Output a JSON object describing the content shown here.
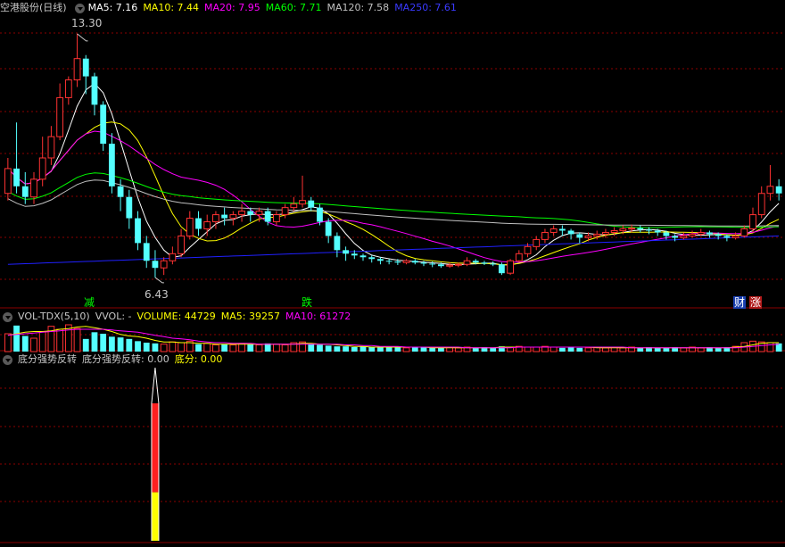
{
  "header_price": {
    "title": "空港股份(日线)",
    "ma5_label": "MA5: 7.16",
    "ma10_label": "MA10: 7.44",
    "ma20_label": "MA20: 7.95",
    "ma60_label": "MA60: 7.71",
    "ma120_label": "MA120: 7.58",
    "ma250_label": "MA250: 7.61"
  },
  "header_volume": {
    "title": "VOL-TDX(5,10)",
    "vvol_label": "VVOL: -",
    "volume_label": "VOLUME: 44729",
    "ma5_label": "MA5: 39257",
    "ma10_label": "MA10: 61272"
  },
  "header_indicator": {
    "title": "底分强势反转",
    "value_label": "底分强势反转: 0.00",
    "bottom_label": "底分: 0.00"
  },
  "markers": {
    "high": "13.30",
    "low": "6.43",
    "m1": "减",
    "m2": "跌",
    "m3": "财",
    "m4": "涨"
  },
  "colors": {
    "up": "#ff3232",
    "down": "#54ffff",
    "ma5": "#ffffff",
    "ma10": "#ffff00",
    "ma20": "#ff00ff",
    "ma60": "#00ff00",
    "ma120": "#c0c0c0",
    "ma250": "#2020ff",
    "grid": "#8b0000"
  },
  "chart_data": [
    {
      "type": "candlestick",
      "title": "空港股份(日线)",
      "ylim": [
        5.9,
        13.8
      ],
      "price_high": 13.3,
      "price_low": 6.43,
      "candles": [
        [
          8.8,
          9.5,
          9.8,
          8.6
        ],
        [
          9.5,
          9.0,
          10.8,
          8.8
        ],
        [
          9.0,
          8.7,
          9.4,
          8.5
        ],
        [
          8.7,
          9.2,
          9.4,
          8.5
        ],
        [
          9.2,
          9.8,
          10.4,
          9.0
        ],
        [
          9.8,
          10.4,
          10.7,
          9.6
        ],
        [
          10.4,
          11.5,
          11.9,
          10.3
        ],
        [
          11.5,
          12.0,
          12.1,
          11.3
        ],
        [
          12.0,
          12.6,
          13.3,
          11.8
        ],
        [
          12.6,
          12.1,
          12.7,
          11.6
        ],
        [
          12.1,
          11.3,
          12.2,
          11.0
        ],
        [
          11.3,
          10.2,
          11.4,
          10.0
        ],
        [
          10.2,
          9.0,
          10.5,
          8.8
        ],
        [
          9.0,
          8.7,
          9.2,
          8.3
        ],
        [
          8.7,
          8.1,
          8.9,
          7.8
        ],
        [
          8.1,
          7.4,
          8.3,
          7.2
        ],
        [
          7.4,
          6.9,
          7.6,
          6.7
        ],
        [
          6.9,
          6.7,
          7.2,
          6.43
        ],
        [
          6.7,
          6.9,
          7.0,
          6.5
        ],
        [
          6.9,
          7.1,
          7.3,
          6.8
        ],
        [
          7.1,
          7.6,
          7.8,
          7.0
        ],
        [
          7.6,
          8.1,
          8.3,
          7.5
        ],
        [
          8.1,
          7.8,
          8.3,
          7.6
        ],
        [
          7.8,
          8.0,
          8.2,
          7.6
        ],
        [
          8.0,
          8.2,
          8.3,
          7.8
        ],
        [
          8.2,
          8.1,
          8.4,
          7.9
        ],
        [
          8.1,
          8.2,
          8.3,
          7.9
        ],
        [
          8.2,
          8.3,
          8.5,
          8.0
        ],
        [
          8.3,
          8.2,
          8.4,
          8.0
        ],
        [
          8.2,
          8.3,
          8.4,
          8.0
        ],
        [
          8.3,
          8.0,
          8.4,
          7.9
        ],
        [
          8.0,
          8.2,
          8.3,
          7.9
        ],
        [
          8.2,
          8.4,
          8.5,
          8.1
        ],
        [
          8.4,
          8.5,
          8.7,
          8.3
        ],
        [
          8.5,
          8.6,
          9.3,
          8.4
        ],
        [
          8.6,
          8.4,
          8.7,
          8.3
        ],
        [
          8.4,
          8.0,
          8.5,
          7.9
        ],
        [
          8.0,
          7.6,
          8.1,
          7.4
        ],
        [
          7.6,
          7.2,
          7.7,
          7.0
        ],
        [
          7.2,
          7.1,
          7.3,
          6.9
        ],
        [
          7.1,
          7.05,
          7.2,
          6.95
        ],
        [
          7.05,
          7.0,
          7.1,
          6.9
        ],
        [
          7.0,
          6.95,
          7.05,
          6.85
        ],
        [
          6.95,
          6.9,
          7.0,
          6.8
        ],
        [
          6.9,
          6.88,
          6.95,
          6.8
        ],
        [
          6.88,
          6.85,
          6.95,
          6.78
        ],
        [
          6.85,
          6.9,
          6.95,
          6.8
        ],
        [
          6.9,
          6.85,
          6.95,
          6.8
        ],
        [
          6.85,
          6.82,
          6.9,
          6.75
        ],
        [
          6.82,
          6.8,
          6.88,
          6.72
        ],
        [
          6.8,
          6.75,
          6.85,
          6.7
        ],
        [
          6.75,
          6.78,
          6.85,
          6.7
        ],
        [
          6.78,
          6.8,
          6.85,
          6.72
        ],
        [
          6.8,
          6.9,
          7.0,
          6.75
        ],
        [
          6.9,
          6.85,
          6.95,
          6.8
        ],
        [
          6.85,
          6.82,
          6.9,
          6.78
        ],
        [
          6.82,
          6.8,
          6.88,
          6.75
        ],
        [
          6.8,
          6.55,
          6.85,
          6.5
        ],
        [
          6.55,
          6.9,
          6.95,
          6.5
        ],
        [
          6.9,
          7.1,
          7.2,
          6.85
        ],
        [
          7.1,
          7.3,
          7.4,
          7.0
        ],
        [
          7.3,
          7.5,
          7.6,
          7.2
        ],
        [
          7.5,
          7.7,
          7.8,
          7.4
        ],
        [
          7.7,
          7.8,
          7.9,
          7.6
        ],
        [
          7.8,
          7.75,
          7.9,
          7.6
        ],
        [
          7.75,
          7.65,
          7.8,
          7.5
        ],
        [
          7.65,
          7.55,
          7.7,
          7.4
        ],
        [
          7.55,
          7.6,
          7.7,
          7.45
        ],
        [
          7.6,
          7.65,
          7.75,
          7.5
        ],
        [
          7.65,
          7.7,
          7.8,
          7.55
        ],
        [
          7.7,
          7.75,
          7.85,
          7.6
        ],
        [
          7.75,
          7.8,
          7.9,
          7.65
        ],
        [
          7.8,
          7.82,
          7.92,
          7.7
        ],
        [
          7.82,
          7.78,
          7.9,
          7.7
        ],
        [
          7.78,
          7.75,
          7.85,
          7.65
        ],
        [
          7.75,
          7.7,
          7.8,
          7.6
        ],
        [
          7.7,
          7.6,
          7.75,
          7.5
        ],
        [
          7.6,
          7.55,
          7.65,
          7.45
        ],
        [
          7.55,
          7.6,
          7.7,
          7.5
        ],
        [
          7.6,
          7.65,
          7.75,
          7.55
        ],
        [
          7.65,
          7.7,
          7.8,
          7.6
        ],
        [
          7.7,
          7.65,
          7.75,
          7.55
        ],
        [
          7.65,
          7.6,
          7.7,
          7.5
        ],
        [
          7.6,
          7.55,
          7.65,
          7.45
        ],
        [
          7.55,
          7.6,
          7.7,
          7.5
        ],
        [
          7.6,
          7.8,
          7.9,
          7.55
        ],
        [
          7.8,
          8.2,
          8.4,
          7.7
        ],
        [
          8.2,
          8.8,
          9.0,
          8.1
        ],
        [
          8.8,
          9.0,
          9.6,
          8.6
        ],
        [
          9.0,
          8.8,
          9.2,
          8.6
        ]
      ]
    },
    {
      "type": "bar",
      "title": "VOL-TDX(5,10)",
      "volume": [
        24,
        35,
        21,
        18,
        27,
        34,
        30,
        36,
        31,
        17,
        26,
        24,
        20,
        19,
        17,
        14,
        12,
        11,
        10,
        13,
        12,
        14,
        10,
        11,
        9,
        10,
        9,
        11,
        10,
        9,
        11,
        10,
        9,
        12,
        13,
        10,
        9,
        8,
        7,
        7,
        6,
        7,
        6,
        6,
        6,
        6,
        5,
        6,
        6,
        5,
        5,
        6,
        5,
        6,
        5,
        6,
        5,
        7,
        6,
        7,
        6,
        6,
        7,
        6,
        5,
        6,
        5,
        5,
        6,
        5,
        6,
        5,
        6,
        5,
        6,
        5,
        5,
        6,
        5,
        6,
        5,
        6,
        5,
        6,
        7,
        12,
        14,
        13,
        12,
        11
      ],
      "vol_ma5": [
        22,
        24,
        26,
        27,
        27,
        28,
        30,
        31,
        33,
        34,
        32,
        30,
        27,
        23,
        21,
        20,
        18,
        15,
        13,
        13,
        12,
        12,
        11,
        11,
        10,
        10,
        10,
        10,
        10,
        10,
        10,
        10,
        10,
        10,
        11,
        11,
        10,
        10,
        9,
        8,
        7,
        7,
        6,
        6,
        6,
        6,
        6,
        6,
        6,
        5,
        5,
        5,
        5,
        5,
        5,
        5,
        5,
        6,
        6,
        6,
        6,
        6,
        6,
        6,
        6,
        6,
        6,
        6,
        5,
        5,
        5,
        5,
        5,
        5,
        5,
        5,
        5,
        5,
        5,
        5,
        5,
        5,
        5,
        5,
        6,
        7,
        9,
        11,
        12,
        12
      ],
      "vol_ma10": [
        22,
        23,
        24,
        25,
        26,
        27,
        28,
        29,
        30,
        30,
        30,
        30,
        29,
        28,
        27,
        26,
        24,
        22,
        20,
        18,
        17,
        16,
        14,
        13,
        12,
        12,
        11,
        11,
        11,
        10,
        10,
        10,
        10,
        10,
        10,
        10,
        10,
        10,
        10,
        9,
        9,
        8,
        8,
        7,
        7,
        7,
        6,
        6,
        6,
        6,
        6,
        6,
        6,
        5,
        5,
        5,
        5,
        5,
        5,
        6,
        6,
        6,
        6,
        6,
        6,
        6,
        6,
        6,
        6,
        6,
        6,
        6,
        5,
        5,
        5,
        5,
        5,
        5,
        5,
        5,
        5,
        5,
        5,
        5,
        5,
        6,
        7,
        8,
        9,
        10
      ]
    },
    {
      "type": "bar",
      "title": "底分强势反转",
      "signal_index": 17,
      "signal_value": 1.0,
      "bottom_value": 0.28
    }
  ]
}
